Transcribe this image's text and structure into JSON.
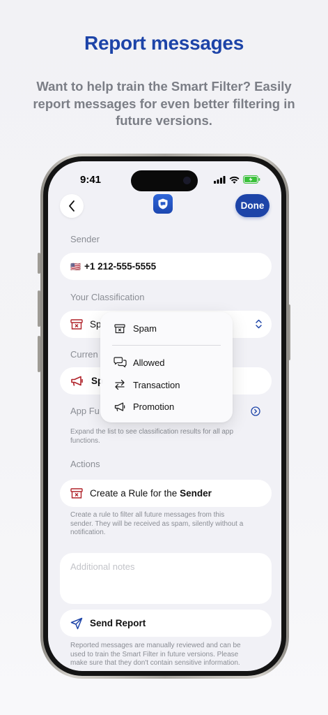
{
  "promo": {
    "headline": "Report messages",
    "subline": "Want to help train the Smart Filter? Easily report messages for even better filtering in future versions."
  },
  "status_bar": {
    "time": "9:41"
  },
  "nav": {
    "done_label": "Done",
    "back_icon": "chevron-left-icon",
    "app_icon": "shield-chat-icon"
  },
  "sender": {
    "label": "Sender",
    "flag": "🇺🇸",
    "phone": "+1 212-555-5555"
  },
  "classification": {
    "label": "Your Classification",
    "value_visible": "Sp",
    "selected": "Spam"
  },
  "current": {
    "label_visible": "Curren",
    "value_visible": "Sp"
  },
  "app_functions": {
    "label_visible": "App Fu",
    "hint": "Expand the list to see classification results for all app functions."
  },
  "actions": {
    "label": "Actions",
    "rule_prefix": "Create a Rule for the ",
    "rule_bold": "Sender",
    "rule_hint": "Create a rule to filter all future messages from this sender. They will be received as spam, silently without a notification."
  },
  "notes": {
    "placeholder": "Additional notes"
  },
  "send": {
    "label": "Send Report",
    "hint": "Reported messages are manually reviewed and can be used to train the Smart Filter in future versions. Please make sure that they don't contain sensitive information."
  },
  "dropdown": {
    "top": {
      "label": "Spam",
      "icon": "spam-bin-icon"
    },
    "items": [
      {
        "label": "Allowed",
        "icon": "chat-bubbles-icon"
      },
      {
        "label": "Transaction",
        "icon": "arrows-swap-icon"
      },
      {
        "label": "Promotion",
        "icon": "megaphone-icon"
      }
    ]
  },
  "colors": {
    "accent": "#1d44a8",
    "spam_red": "#b0232a",
    "muted_text": "#8a8d94"
  }
}
